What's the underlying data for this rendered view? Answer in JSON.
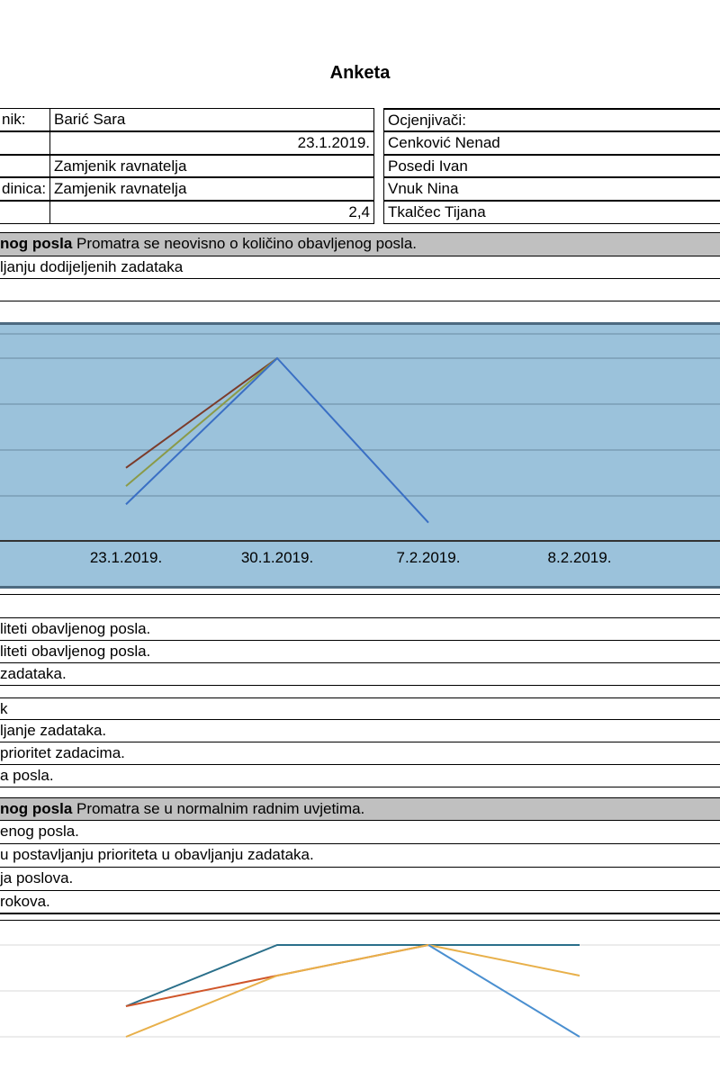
{
  "title": "Anketa",
  "left_table": [
    {
      "label": "nik:",
      "value": "Barić Sara",
      "align": "left"
    },
    {
      "label": "",
      "value": "23.1.2019.",
      "align": "right"
    },
    {
      "label": "",
      "value": "Zamjenik ravnatelja",
      "align": "left"
    },
    {
      "label": "dinica:",
      "value": "Zamjenik ravnatelja",
      "align": "left"
    },
    {
      "label": "",
      "value": "2,4",
      "align": "right"
    }
  ],
  "right_table": [
    "Ocjenjivači:",
    "Cenković Nenad",
    "Posedi Ivan",
    "Vnuk Nina",
    "Tkalčec Tijana"
  ],
  "section1": {
    "header_bold": "nog posla",
    "header_text": " Promatra se neovisno o količino obavljenog posla.",
    "rows": [
      "ljanju dodijeljenih zadataka",
      ""
    ]
  },
  "chart1": {
    "x_labels": [
      "23.1.2019.",
      "30.1.2019.",
      "7.2.2019.",
      "8.2.2019."
    ]
  },
  "rows_block2": [
    "",
    "liteti obavljenog posla.",
    "liteti obavljenog posla.",
    "zadataka."
  ],
  "rows_block3": [
    "k",
    "ljanje zadataka.",
    "prioritet zadacima.",
    "a posla."
  ],
  "section2": {
    "header_bold": "nog posla",
    "header_text": " Promatra se u normalnim radnim uvjetima.",
    "rows": [
      "enog posla.",
      "u postavljanju prioriteta u obavljanju zadataka.",
      "ja poslova.",
      " rokova."
    ]
  },
  "chart_data": [
    {
      "type": "line",
      "x": [
        "23.1.2019.",
        "30.1.2019.",
        "7.2.2019.",
        "8.2.2019."
      ],
      "series": [
        {
          "values": [
            2,
            5,
            null,
            null
          ],
          "color": "#7b3b2a"
        },
        {
          "values": [
            1.5,
            5,
            null,
            null
          ],
          "color": "#8a9a48"
        },
        {
          "values": [
            1,
            5,
            0.5,
            null
          ],
          "color": "#3a6fc4"
        }
      ],
      "grid": true
    },
    {
      "type": "line",
      "x": [
        1,
        2,
        3,
        4
      ],
      "series": [
        {
          "values": [
            2,
            4,
            4,
            4
          ],
          "color": "#2a6f8a"
        },
        {
          "values": [
            2,
            3,
            4,
            null
          ],
          "color": "#d0562a"
        },
        {
          "values": [
            1,
            3,
            4,
            3
          ],
          "color": "#e8b04a"
        },
        {
          "values": [
            null,
            null,
            4,
            1
          ],
          "color": "#4a8fd0"
        }
      ],
      "grid": true
    }
  ]
}
